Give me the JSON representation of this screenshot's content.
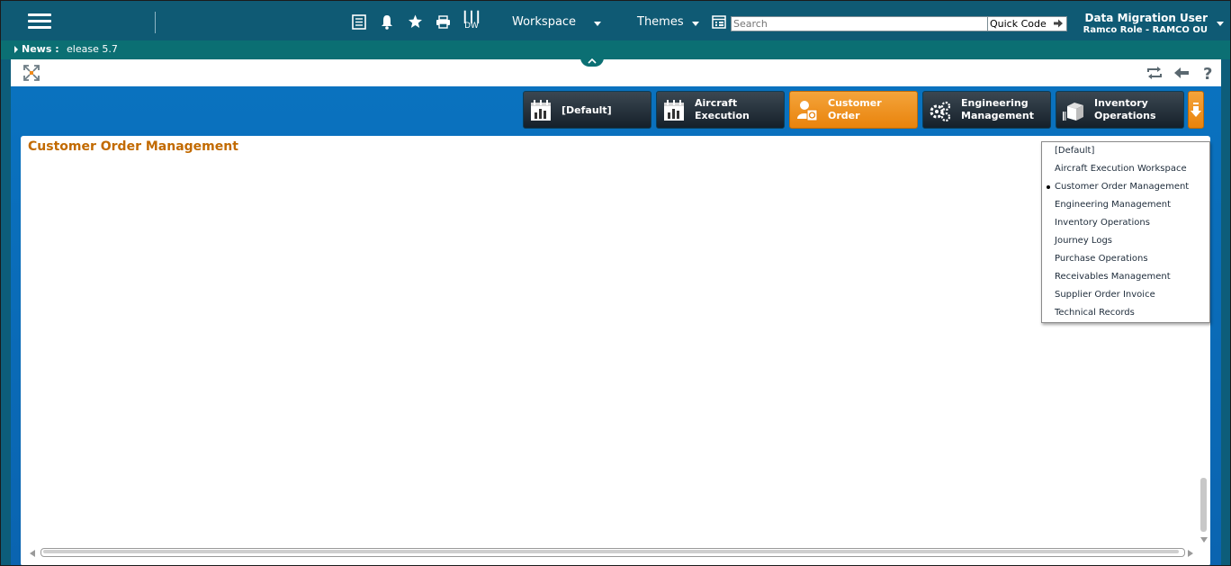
{
  "header": {
    "menu_icon": "hamburger-menu-icon",
    "icons": [
      "list-icon",
      "bell-icon",
      "star-icon",
      "printer-icon"
    ],
    "dw_label": "DW",
    "workspace_label": "Workspace",
    "themes_label": "Themes",
    "search_placeholder": "Search",
    "quick_code_label": "Quick Code",
    "user_name": "Data Migration User",
    "user_role": "Ramco Role - RAMCO OU"
  },
  "news": {
    "label": "News :",
    "text": "elease 5.7"
  },
  "workspace_tabs": [
    {
      "line1": "[Default]",
      "line2": "",
      "icon": "calendar-chart-icon",
      "active": false
    },
    {
      "line1": "Aircraft",
      "line2": "Execution",
      "icon": "calendar-chart-icon",
      "active": false
    },
    {
      "line1": "Customer",
      "line2": "Order",
      "icon": "customer-order-icon",
      "active": true
    },
    {
      "line1": "Engineering",
      "line2": "Management",
      "icon": "gears-icon",
      "active": false
    },
    {
      "line1": "Inventory",
      "line2": "Operations",
      "icon": "inventory-boxes-icon",
      "active": false
    }
  ],
  "panel": {
    "title": "Customer Order Management"
  },
  "dropdown": {
    "items": [
      "[Default]",
      "Aircraft Execution Workspace",
      "Customer Order Management",
      "Engineering Management",
      "Inventory Operations",
      "Journey Logs",
      "Purchase Operations",
      "Receivables Management",
      "Supplier Order Invoice",
      "Technical Records"
    ],
    "selected_index": 2
  },
  "colors": {
    "header_bg": "#0f5a74",
    "news_bg": "#0b6f73",
    "work_bg": "#0a6bb8",
    "active_tab": "#ef9222",
    "title_color": "#c26a00"
  }
}
